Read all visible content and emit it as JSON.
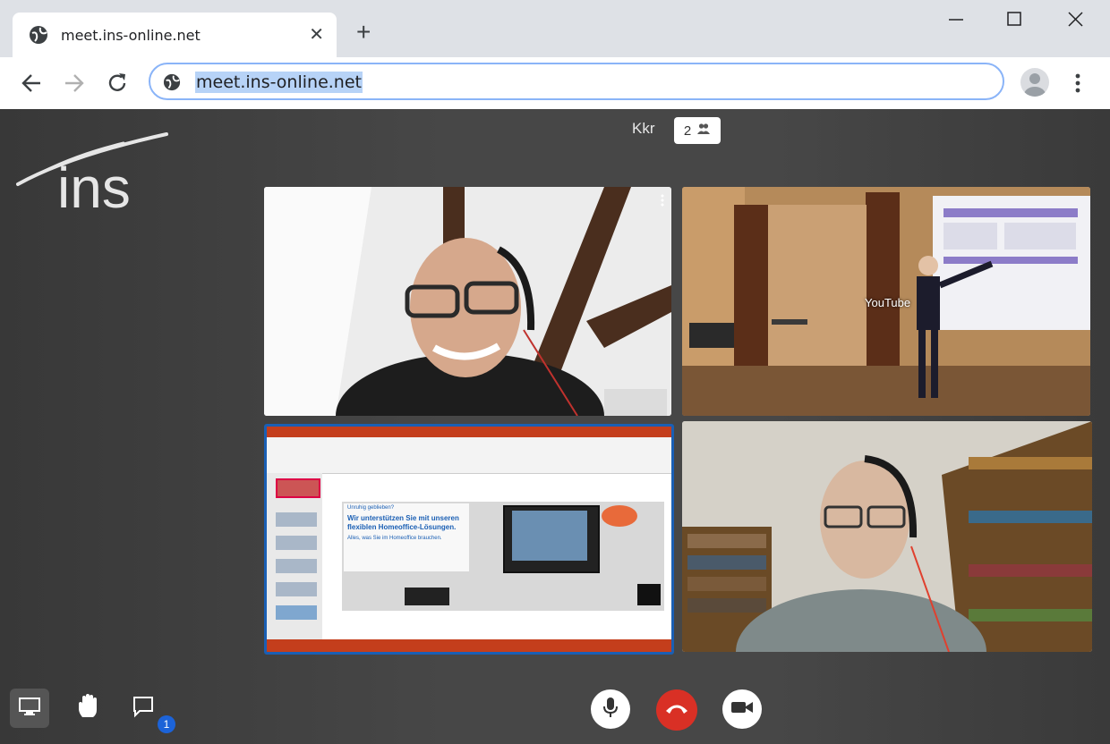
{
  "browser": {
    "tab_title": "meet.ins-online.net",
    "url": "meet.ins-online.net",
    "new_tab": "+",
    "close_tab": "✕"
  },
  "meeting": {
    "logo_text": "ins",
    "room_name": "Kkr",
    "participant_count": "2",
    "tiles": [
      {
        "label": ""
      },
      {
        "label": "YouTube"
      },
      {
        "slide_badge": "Unruhig geblieben?",
        "slide_heading": "Wir unterstützen Sie mit unseren flexiblen Homeoffice-Lösungen.",
        "slide_sub": "Alles, was Sie im Homeoffice brauchen."
      },
      {
        "label": ""
      }
    ]
  },
  "controls": {
    "chat_badge": "1"
  },
  "colors": {
    "hangup": "#d93025",
    "accent": "#1a5fb4",
    "badge": "#1c63d8"
  }
}
